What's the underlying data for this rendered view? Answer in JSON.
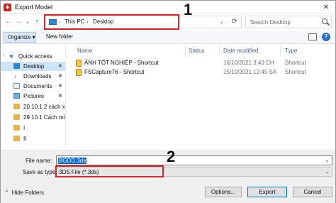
{
  "window": {
    "title": "Export Model",
    "close_glyph": "✕"
  },
  "nav_buttons": {
    "back": "←",
    "forward": "→",
    "recent": "⌄",
    "up": "↑"
  },
  "address": {
    "crumbs": [
      "This PC",
      "Desktop"
    ],
    "separator": "›",
    "dropdown": "⌄",
    "refresh": "⟳"
  },
  "search": {
    "placeholder": "Search Desktop"
  },
  "annotations": {
    "badge1": "1",
    "badge2": "2",
    "color": "#d9262c"
  },
  "toolbar": {
    "organize": "Organize ▾",
    "new_folder": "New folder",
    "help": "?"
  },
  "sidebar": {
    "items": [
      {
        "label": "Quick access",
        "icon": "star-icon",
        "pinned": false
      },
      {
        "label": "Desktop",
        "icon": "desktop-icon",
        "pinned": true,
        "selected": true
      },
      {
        "label": "Downloads",
        "icon": "download-icon",
        "pinned": true
      },
      {
        "label": "Documents",
        "icon": "document-icon",
        "pinned": true
      },
      {
        "label": "Pictures",
        "icon": "pictures-icon",
        "pinned": true
      },
      {
        "label": "20.10.1 2 cách xó",
        "icon": "folder-icon",
        "pinned": false
      },
      {
        "label": "29.10.1 Cách mở",
        "icon": "folder-icon",
        "pinned": false
      },
      {
        "label": "I",
        "icon": "folder-icon",
        "pinned": false
      },
      {
        "label": "II",
        "icon": "folder-icon",
        "pinned": false
      }
    ],
    "pin_glyph": "✱",
    "expand_glyph": "›"
  },
  "columns": {
    "name": "Name",
    "status": "Status",
    "date": "Date modified",
    "type": "Type"
  },
  "files": [
    {
      "name": "ẢNH TỐT NGHIỆP - Shortcut",
      "date": "16/10/2021 3:43 CH",
      "type": "Shortcut"
    },
    {
      "name": "FSCapture76 - Shortcut",
      "date": "15/10/2021 12:45 SA",
      "type": "Shortcut"
    }
  ],
  "bottom": {
    "file_name_label": "File name:",
    "file_name_value": "BGDD.3ds",
    "save_type_label": "Save as type:",
    "save_type_value": "3DS File (*.3ds)",
    "hide_folders": "Hide Folders",
    "hide_chevron": "⌃",
    "options": "Options...",
    "export": "Export",
    "cancel": "Cancel"
  }
}
